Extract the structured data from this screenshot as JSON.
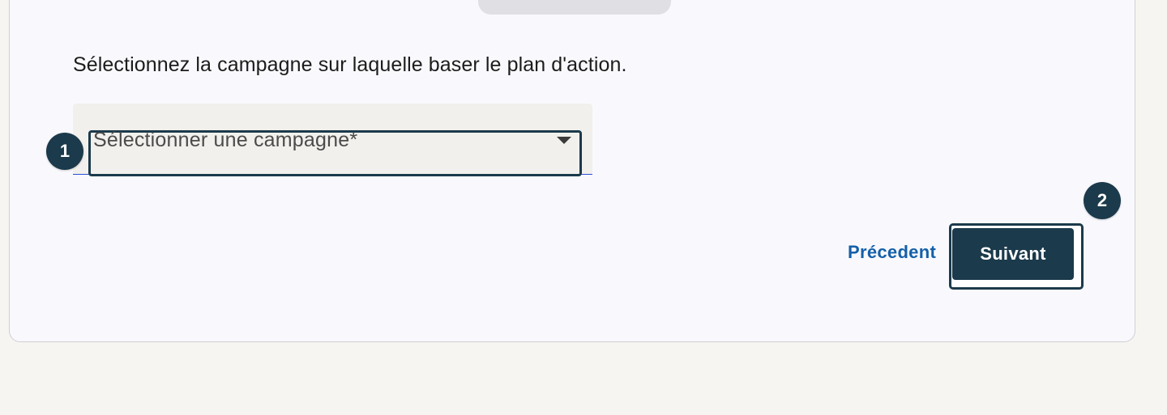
{
  "step": {
    "instruction": "Sélectionnez la campagne sur laquelle baser le plan d'action."
  },
  "campaign_select": {
    "placeholder": "Sélectionner une campagne*",
    "icon": "caret-down-icon"
  },
  "annotations": {
    "badge_1": "1",
    "badge_2": "2"
  },
  "footer": {
    "previous_label": "Précedent",
    "next_label": "Suivant"
  },
  "colors": {
    "primary": "#1b3a4b",
    "link": "#1560a8",
    "field_underline": "#2d4fd8"
  }
}
